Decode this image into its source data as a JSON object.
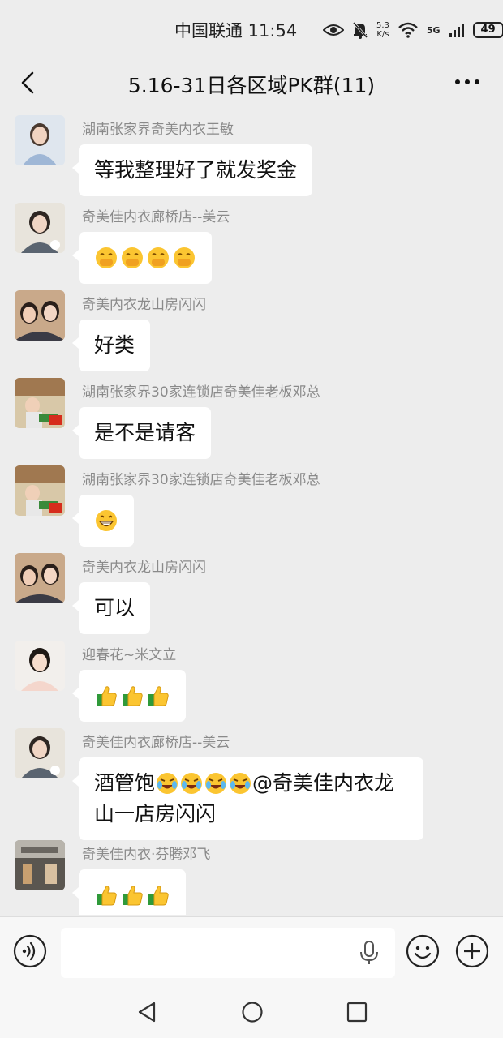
{
  "status_bar": {
    "carrier_time": "中国联通 11:54",
    "net_speed_value": "5.3",
    "net_speed_unit": "K/s",
    "signal_label": "5G",
    "battery": "49"
  },
  "header": {
    "title": "5.16-31日各区域PK群(11)"
  },
  "messages": [
    {
      "sender": "湖南张家界奇美内衣王敏",
      "text": "等我整理好了就发奖金"
    },
    {
      "sender": "奇美佳内衣廊桥店--美云",
      "emojis": [
        "hand-over-mouth",
        "hand-over-mouth",
        "hand-over-mouth",
        "hand-over-mouth"
      ]
    },
    {
      "sender": "奇美内衣龙山房闪闪",
      "text": "好类"
    },
    {
      "sender": "湖南张家界30家连锁店奇美佳老板邓总",
      "text": "是不是请客"
    },
    {
      "sender": "湖南张家界30家连锁店奇美佳老板邓总",
      "emojis": [
        "grin"
      ]
    },
    {
      "sender": "奇美内衣龙山房闪闪",
      "text": "可以"
    },
    {
      "sender": "迎春花~米文立",
      "emojis": [
        "thumbs-up",
        "thumbs-up",
        "thumbs-up"
      ]
    },
    {
      "sender": "奇美佳内衣廊桥店--美云",
      "text_line1_prefix": "酒管饱",
      "text_line1_suffix": "@奇美佳内衣龙",
      "text_line2": "山一店房闪闪",
      "emojis": [
        "crying-laugh",
        "crying-laugh",
        "crying-laugh",
        "crying-laugh"
      ]
    },
    {
      "sender": "奇美佳内衣·芬腾邓飞",
      "emojis": [
        "thumbs-up",
        "thumbs-up",
        "thumbs-up"
      ]
    }
  ],
  "input": {
    "placeholder": ""
  },
  "colors": {
    "background": "#ededed",
    "bubble": "#ffffff",
    "sender_text": "#8a8a8a"
  },
  "icons": {
    "status": [
      "eye-icon",
      "bell-mute-icon",
      "wifi-icon",
      "signal-icon",
      "battery-icon"
    ],
    "header": [
      "back-arrow-icon",
      "more-icon"
    ],
    "input": [
      "voice-icon",
      "mic-icon",
      "emoji-icon",
      "plus-icon"
    ],
    "nav": [
      "nav-back-icon",
      "nav-home-icon",
      "nav-recent-icon"
    ]
  }
}
